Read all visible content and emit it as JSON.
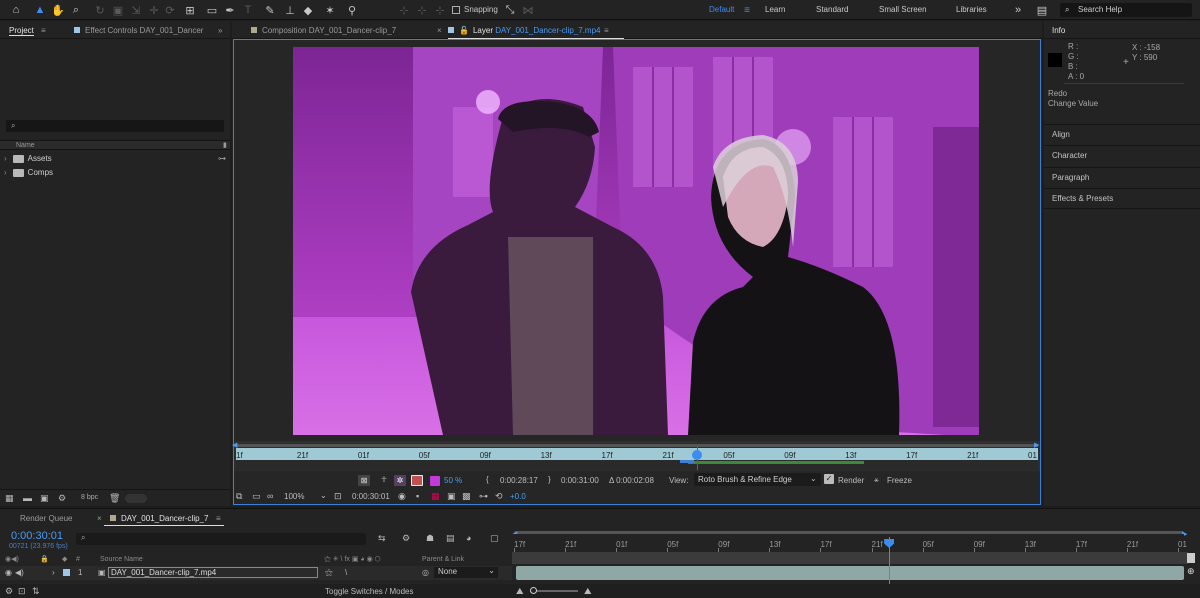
{
  "toolbar": {
    "tools": [
      "home-icon",
      "selection-tool-icon",
      "hand-tool-icon",
      "zoom-tool-icon",
      "orbit-camera-icon",
      "pan-camera-icon",
      "dolly-camera-icon",
      "anchor-point-icon",
      "rotation-tool-icon",
      "rectangle-tool-icon",
      "pen-tool-icon",
      "type-tool-icon",
      "brush-tool-icon",
      "clone-stamp-icon",
      "eraser-tool-icon",
      "roto-brush-icon",
      "puppet-pin-icon"
    ],
    "snapping_label": "Snapping",
    "workspaces": [
      "Default",
      "Learn",
      "Standard",
      "Small Screen",
      "Libraries"
    ],
    "active_workspace": "Default",
    "search_placeholder": "Search Help"
  },
  "project_panel": {
    "tab_project": "Project",
    "tab_effect_controls": "Effect Controls DAY_001_Dancer",
    "column_name": "Name",
    "items": [
      {
        "label": "Assets"
      },
      {
        "label": "Comps"
      }
    ],
    "bpc": "8 bpc"
  },
  "viewer": {
    "tab_composition": "Composition DAY_001_Dancer-clip_7",
    "tab_layer_prefix": "Layer",
    "tab_layer_name": "DAY_001_Dancer-clip_7.mp4",
    "ruler_ticks": [
      "1f",
      "21f",
      "01f",
      "05f",
      "09f",
      "13f",
      "17f",
      "21f",
      "05f",
      "09f",
      "13f",
      "17f",
      "21f",
      "01"
    ],
    "playhead_fraction": 0.575,
    "overlay_opacity": "50 %",
    "current_time": "0:00:28:17",
    "out_time": "0:00:31:00",
    "duration": "Δ 0:00:02:08",
    "view_label": "View:",
    "view_value": "Roto Brush & Refine Edge",
    "render_label": "Render",
    "freeze_label": "Freeze",
    "zoom": "100%",
    "timecode": "0:00:30:01",
    "exposure": "+0.0",
    "overlay_color": "#b43ad0",
    "accent": "#3d7fd4"
  },
  "info_panel": {
    "title": "Info",
    "r": "R :",
    "g": "G :",
    "b": "B :",
    "a": "A : 0",
    "x": "X : -158",
    "y": "Y : 590",
    "redo": "Redo",
    "redo_value": "Change Value",
    "panels": [
      "Align",
      "Character",
      "Paragraph",
      "Effects & Presets"
    ]
  },
  "timeline": {
    "tab_render_queue": "Render Queue",
    "tab_comp": "DAY_001_Dancer-clip_7",
    "timecode": "0:00:30:01",
    "frames_fps": "00721 (23.976 fps)",
    "col_hash": "#",
    "col_source": "Source Name",
    "col_parent": "Parent & Link",
    "layer": {
      "index": "1",
      "name": "DAY_001_Dancer-clip_7.mp4",
      "parent": "None"
    },
    "ruler_ticks": [
      "17f",
      "21f",
      "01f",
      "05f",
      "09f",
      "13f",
      "17f",
      "21f",
      "05f",
      "09f",
      "13f",
      "17f",
      "21f",
      "01"
    ],
    "playhead_fraction": 0.565,
    "toggle_label": "Toggle Switches / Modes"
  }
}
